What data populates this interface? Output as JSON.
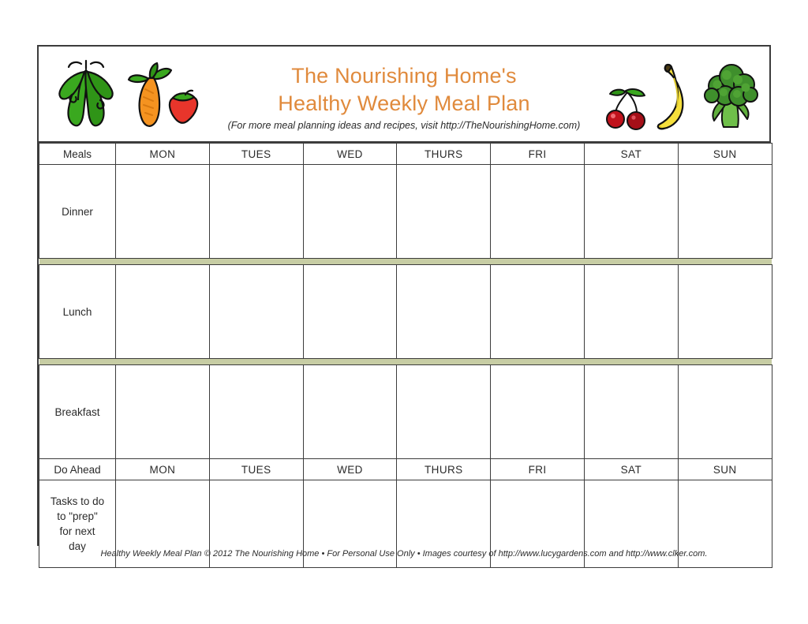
{
  "header": {
    "title_line1": "The Nourishing Home's",
    "title_line2": "Healthy Weekly Meal Plan",
    "subtitle": "(For more meal planning ideas and recipes, visit http://TheNourishingHome.com)",
    "title_color": "#e08a3c",
    "artwork": [
      "pea-pods-illustration",
      "carrot-illustration",
      "strawberry-illustration",
      "cherries-illustration",
      "banana-illustration",
      "broccoli-illustration"
    ]
  },
  "table": {
    "meals_header_label": "Meals",
    "do_ahead_header_label": "Do Ahead",
    "days": [
      "MON",
      "TUES",
      "WED",
      "THURS",
      "FRI",
      "SAT",
      "SUN"
    ],
    "meal_rows": [
      {
        "label": "Dinner",
        "cells": [
          "",
          "",
          "",
          "",
          "",
          "",
          ""
        ]
      },
      {
        "label": "Lunch",
        "cells": [
          "",
          "",
          "",
          "",
          "",
          "",
          ""
        ]
      },
      {
        "label": "Breakfast",
        "cells": [
          "",
          "",
          "",
          "",
          "",
          "",
          ""
        ]
      }
    ],
    "prep_row": {
      "label": "Tasks to do to \"prep\" for next day",
      "label_lines": [
        "Tasks to do",
        "to \"prep\"",
        "for next",
        "day"
      ],
      "cells": [
        "",
        "",
        "",
        "",
        "",
        "",
        ""
      ]
    },
    "colors": {
      "day_header_bg": "#fad4b4",
      "label_header_bg": "#dde8c8",
      "divider_bg": "#c7cda4",
      "border": "#3c3c3c"
    }
  },
  "footer": {
    "text": "Healthy Weekly Meal Plan © 2012 The Nourishing Home • For Personal Use Only • Images courtesy of http://www.lucygardens.com and http://www.clker.com."
  }
}
